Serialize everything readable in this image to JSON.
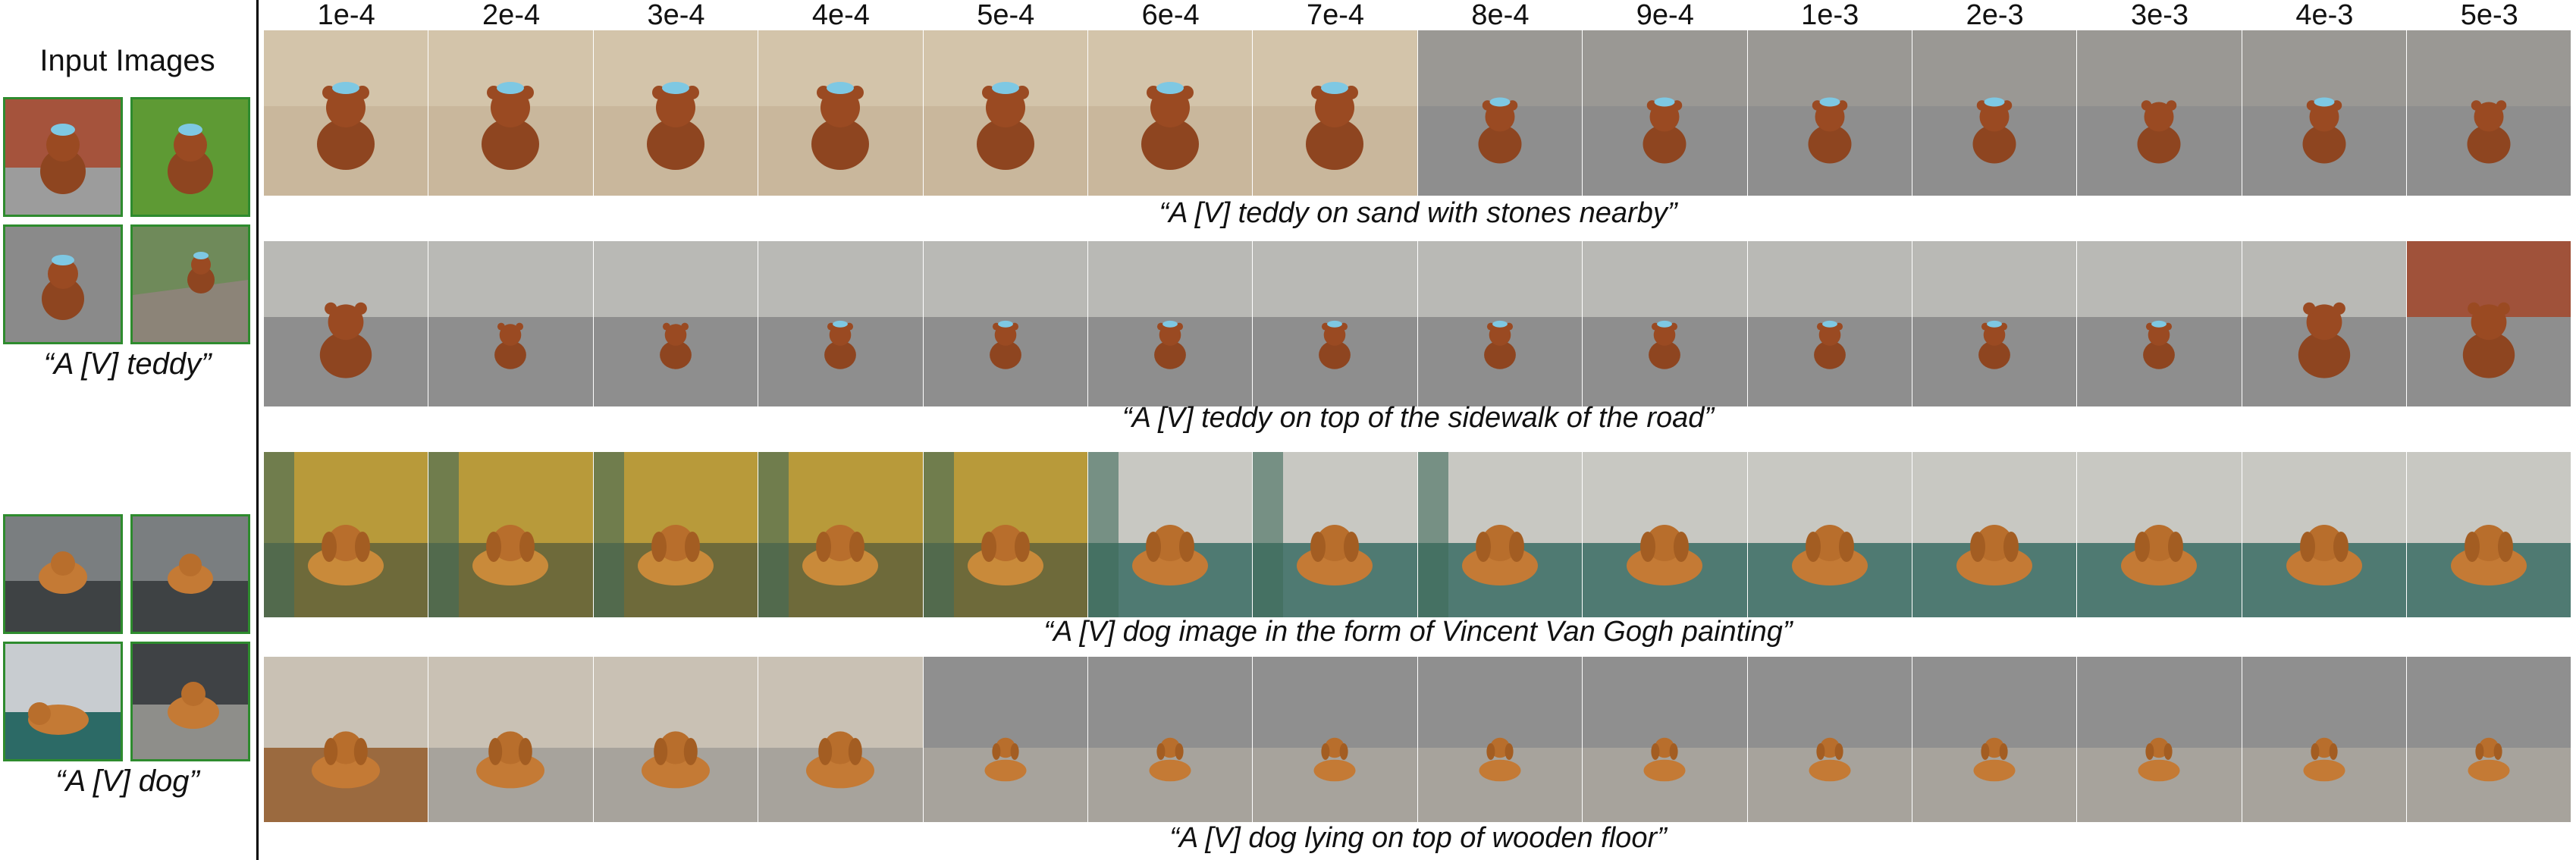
{
  "left_panel": {
    "title": "Input Images",
    "teddy_caption": "“A [V] teddy”",
    "dog_caption": "“A [V] dog”"
  },
  "learning_rates": [
    "1e-4",
    "2e-4",
    "3e-4",
    "4e-4",
    "5e-4",
    "6e-4",
    "7e-4",
    "8e-4",
    "9e-4",
    "1e-3",
    "2e-3",
    "3e-3",
    "4e-3",
    "5e-3"
  ],
  "captions": [
    "“A [V] teddy on sand with stones nearby”",
    "“A [V] teddy on top of the sidewalk of the road”",
    "“A [V] dog image in the form of Vincent Van Gogh painting”",
    "“A [V] dog lying on top of wooden floor”"
  ],
  "colors": {
    "input_border": "#2e8b2e",
    "teddy_fur": "#9a4a22",
    "teddy_hat": "#7ec8e3",
    "sand": "#c9b79c",
    "road": "#8e8e8e",
    "dog_fur": "#c47a35",
    "van_gogh_bg": "#b89a3a",
    "floor": "#a7a39c"
  }
}
